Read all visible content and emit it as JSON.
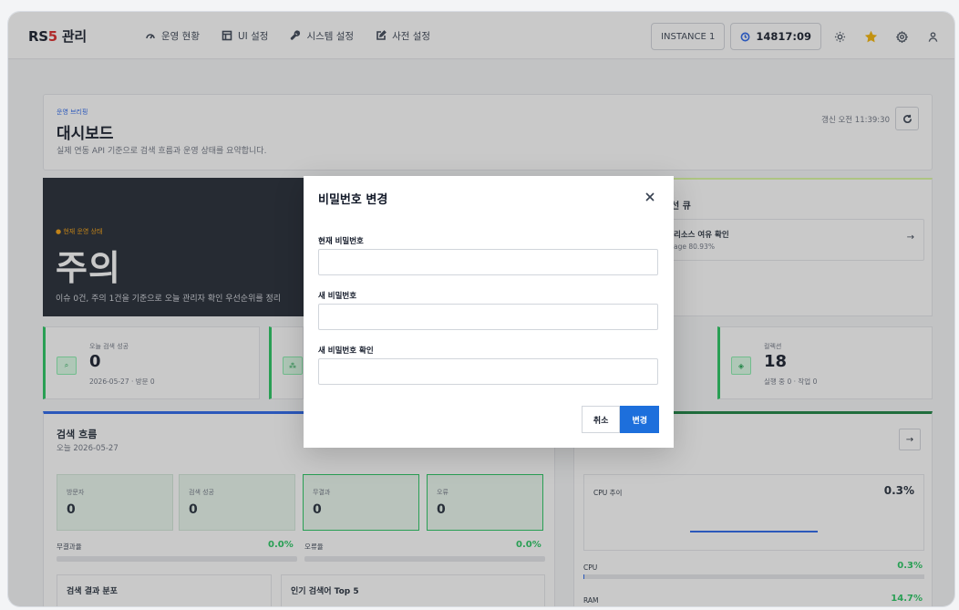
{
  "header": {
    "logo_prefix": "RS",
    "logo_five": "5",
    "logo_suffix": " 관리",
    "nav": [
      {
        "label": "운영 현황",
        "icon": "gauge-icon"
      },
      {
        "label": "UI 설정",
        "icon": "layout-icon"
      },
      {
        "label": "시스템 설정",
        "icon": "wrench-icon"
      },
      {
        "label": "사전 설정",
        "icon": "edit-icon"
      }
    ],
    "instance": "INSTANCE 1",
    "clock": "14817:09",
    "icons": [
      "theme-icon",
      "star-icon",
      "settings-icon",
      "user-icon"
    ],
    "colors": {
      "star": "#f5b301",
      "accent": "#2563eb",
      "logo_red": "#dc2626"
    }
  },
  "briefing": {
    "kicker": "운영 브리핑",
    "title": "대시보드",
    "subtitle": "실제 연동 API 기준으로 검색 흐름과 운영 상태를 요약합니다.",
    "updated": "갱신 오전 11:39:30"
  },
  "status": {
    "kicker": "● 현재 운영 상태",
    "title": "주의",
    "subtitle": "이슈 0건, 주의 1건을 기준으로 오늘 관리자 확인 우선순위를 정리"
  },
  "queue": {
    "title": "선 큐",
    "item_title": "리소스 여유 확인",
    "item_sub": "age 80.93%"
  },
  "kpis": [
    {
      "label": "오늘 검색 성공",
      "value": "0",
      "sub": "2026-05-27 · 방문 0"
    },
    {
      "label": "컬렉션",
      "value": "18",
      "sub": "실행 중 0 · 작업 0"
    }
  ],
  "flow": {
    "title": "검색 흐름",
    "subtitle": "오늘 2026-05-27",
    "stats": [
      {
        "label": "방문자",
        "value": "0"
      },
      {
        "label": "검색 성공",
        "value": "0"
      },
      {
        "label": "무결과",
        "value": "0"
      },
      {
        "label": "오류",
        "value": "0"
      }
    ],
    "no_result_rate_label": "무결과율",
    "no_result_rate": "0.0%",
    "error_rate_label": "오류율",
    "error_rate": "0.0%",
    "dist_title": "검색 결과 분포",
    "top_title": "인기 검색어 Top 5"
  },
  "resources": {
    "cpu_trend_label": "CPU 추이",
    "cpu_trend_value": "0.3%",
    "cpu_label": "CPU",
    "cpu_value": "0.3%",
    "cpu_fraction": 0.003,
    "ram_label": "RAM",
    "ram_value": "14.7%",
    "ram_fraction": 0.147
  },
  "modal": {
    "title": "비밀번호 변경",
    "fields": [
      {
        "label": "현재 비밀번호",
        "value": ""
      },
      {
        "label": "새 비밀번호",
        "value": ""
      },
      {
        "label": "새 비밀번호 확인",
        "value": ""
      }
    ],
    "cancel": "취소",
    "submit": "변경"
  }
}
